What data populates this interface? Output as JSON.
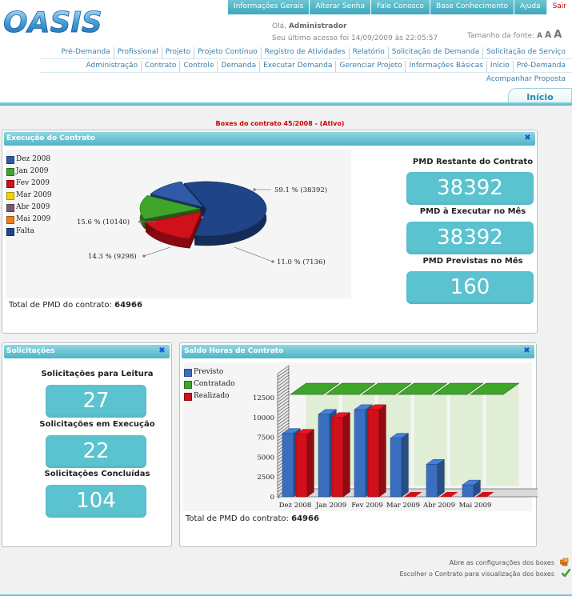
{
  "app": {
    "logo": "OASIS"
  },
  "topnav": [
    {
      "label": "Informações Gerais"
    },
    {
      "label": "Alterar Senha"
    },
    {
      "label": "Fale Conosco"
    },
    {
      "label": "Base Conhecimento"
    },
    {
      "label": "Ajuda"
    },
    {
      "label": "Sair"
    }
  ],
  "user": {
    "greeting": "Olá,",
    "name": "Administrador",
    "last_access": "Seu último acesso foi 14/09/2009 às 22:05:57"
  },
  "font_size": {
    "label": "Tamanho da fonte:",
    "small": "A",
    "medium": "A",
    "large": "A"
  },
  "menu_row1": [
    "Pré-Demanda",
    "Profissional",
    "Projeto",
    "Projeto Contínuo",
    "Registro de Atividades",
    "Relatório",
    "Solicitação de Demanda",
    "Solicitação de Serviço"
  ],
  "menu_row2": [
    "Administração",
    "Contrato",
    "Controle",
    "Demanda",
    "Executar Demanda",
    "Gerenciar Projeto",
    "Informações Básicas",
    "Início",
    "Pré-Demanda"
  ],
  "menu_row3": [
    "Acompanhar Proposta"
  ],
  "active_tab": "Início",
  "boxes_title": "Boxes do contrato 45/2008 - (Ativo)",
  "execucao": {
    "title": "Execução do Contrato",
    "total_label": "Total de PMD do contrato:",
    "total_value": "64966",
    "stats": [
      {
        "label": "PMD Restante do Contrato",
        "value": "38392"
      },
      {
        "label": "PMD à Executar no Mês",
        "value": "38392"
      },
      {
        "label": "PMD Previstas no Mês",
        "value": "160"
      }
    ],
    "legend": [
      {
        "label": "Dez 2008",
        "color": "#2e5aa8"
      },
      {
        "label": "Jan 2009",
        "color": "#3fa52a"
      },
      {
        "label": "Fev 2009",
        "color": "#d0101a"
      },
      {
        "label": "Mar 2009",
        "color": "#f2d400"
      },
      {
        "label": "Abr 2009",
        "color": "#7a5a6e"
      },
      {
        "label": "Mai 2009",
        "color": "#f07a16"
      },
      {
        "label": "Falta",
        "color": "#1f4488"
      }
    ],
    "pie_labels": [
      "59.1 % (38392)",
      "15.6 % (10140)",
      "14.3 % (9298)",
      "11.0 % (7136)"
    ]
  },
  "solicitacoes": {
    "title": "Solicitações",
    "stats": [
      {
        "label": "Solicitações para Leitura",
        "value": "27"
      },
      {
        "label": "Solicitações em Execução",
        "value": "22"
      },
      {
        "label": "Solicitações Concluídas",
        "value": "104"
      }
    ]
  },
  "saldo": {
    "title": "Saldo Horas de Contrato",
    "total_label": "Total de PMD do contrato:",
    "total_value": "64966",
    "legend": [
      {
        "label": "Previsto",
        "color": "#3a6fc0"
      },
      {
        "label": "Contratado",
        "color": "#3fa52a"
      },
      {
        "label": "Realizado",
        "color": "#d0101a"
      }
    ]
  },
  "chart_data": [
    {
      "type": "pie",
      "title": "Execução do Contrato",
      "categories": [
        "Falta",
        "Fev 2009",
        "Jan 2009",
        "Dez 2008"
      ],
      "values": [
        38392,
        10140,
        9298,
        7136
      ],
      "percentages": [
        59.1,
        15.6,
        14.3,
        11.0
      ],
      "colors": [
        "#1f4488",
        "#d0101a",
        "#3fa52a",
        "#2e5aa8"
      ]
    },
    {
      "type": "bar",
      "title": "Saldo Horas de Contrato",
      "categories": [
        "Dez 2008",
        "Jan 2009",
        "Fev 2009",
        "Mar 2009",
        "Abr 2009",
        "Mai 2009"
      ],
      "series": [
        {
          "name": "Previsto",
          "values": [
            8000,
            10400,
            11000,
            7400,
            4100,
            1500
          ],
          "color": "#3a6fc0"
        },
        {
          "name": "Contratado",
          "values": [
            12900,
            12900,
            12900,
            12900,
            12900,
            12900
          ],
          "color": "#3fa52a"
        },
        {
          "name": "Realizado",
          "values": [
            7900,
            10000,
            11000,
            0,
            0,
            0
          ],
          "color": "#d0101a"
        }
      ],
      "yticks": [
        0,
        2500,
        5000,
        7500,
        10000,
        12500
      ],
      "ylim": [
        0,
        12500
      ]
    }
  ],
  "footer": {
    "config_link": "Abre as configurações dos boxes",
    "contract_link": "Escolher o Contrato para visualização dos boxes"
  }
}
